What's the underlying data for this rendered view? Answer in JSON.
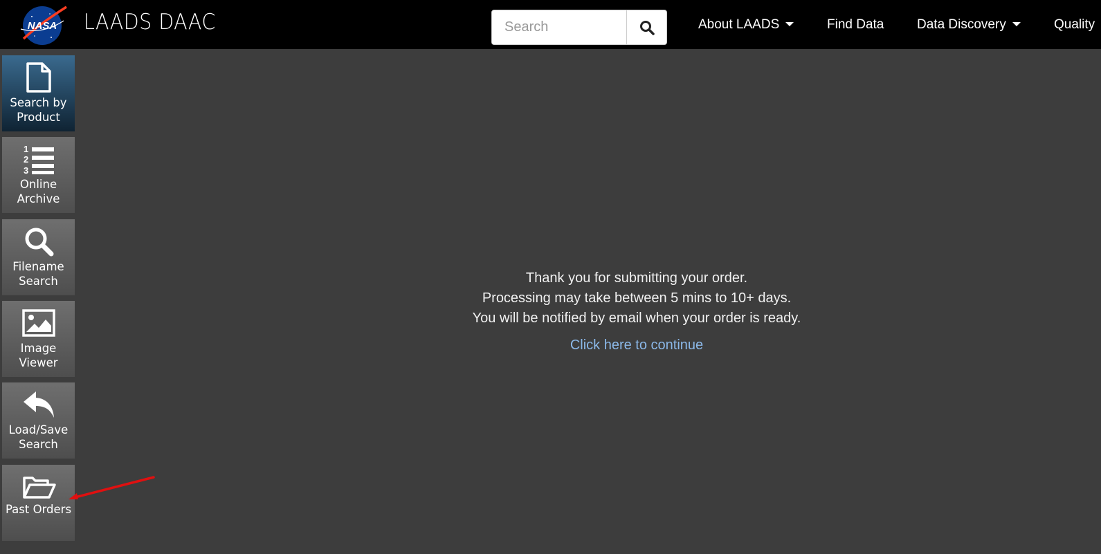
{
  "header": {
    "logo_text": "NASA",
    "brand": "LAADS DAAC",
    "search": {
      "placeholder": "Search",
      "value": ""
    },
    "nav": [
      {
        "label": "About LAADS",
        "dropdown": true
      },
      {
        "label": "Find Data",
        "dropdown": false
      },
      {
        "label": "Data Discovery",
        "dropdown": true
      },
      {
        "label": "Quality",
        "dropdown": false
      }
    ]
  },
  "sidebar": {
    "items": [
      {
        "label": "Search by Product",
        "icon": "file-icon",
        "active": true
      },
      {
        "label": "Online Archive",
        "icon": "numbered-list-icon",
        "active": false
      },
      {
        "label": "Filename Search",
        "icon": "search-icon",
        "active": false
      },
      {
        "label": "Image Viewer",
        "icon": "image-icon",
        "active": false
      },
      {
        "label": "Load/Save Search",
        "icon": "reply-arrow-icon",
        "active": false
      },
      {
        "label": "Past Orders",
        "icon": "folder-open-icon",
        "active": false
      }
    ]
  },
  "main": {
    "message_lines": [
      "Thank you for submitting your order.",
      "Processing may take between 5 mins to 10+ days.",
      "You will be notified by email when your order is ready."
    ],
    "continue_link": "Click here to continue"
  },
  "colors": {
    "topbar": "#000000",
    "background": "#3d3d3d",
    "active_sidebar": "#1f4a6a",
    "link": "#8bb8e8",
    "annotation_arrow": "#e01010"
  }
}
